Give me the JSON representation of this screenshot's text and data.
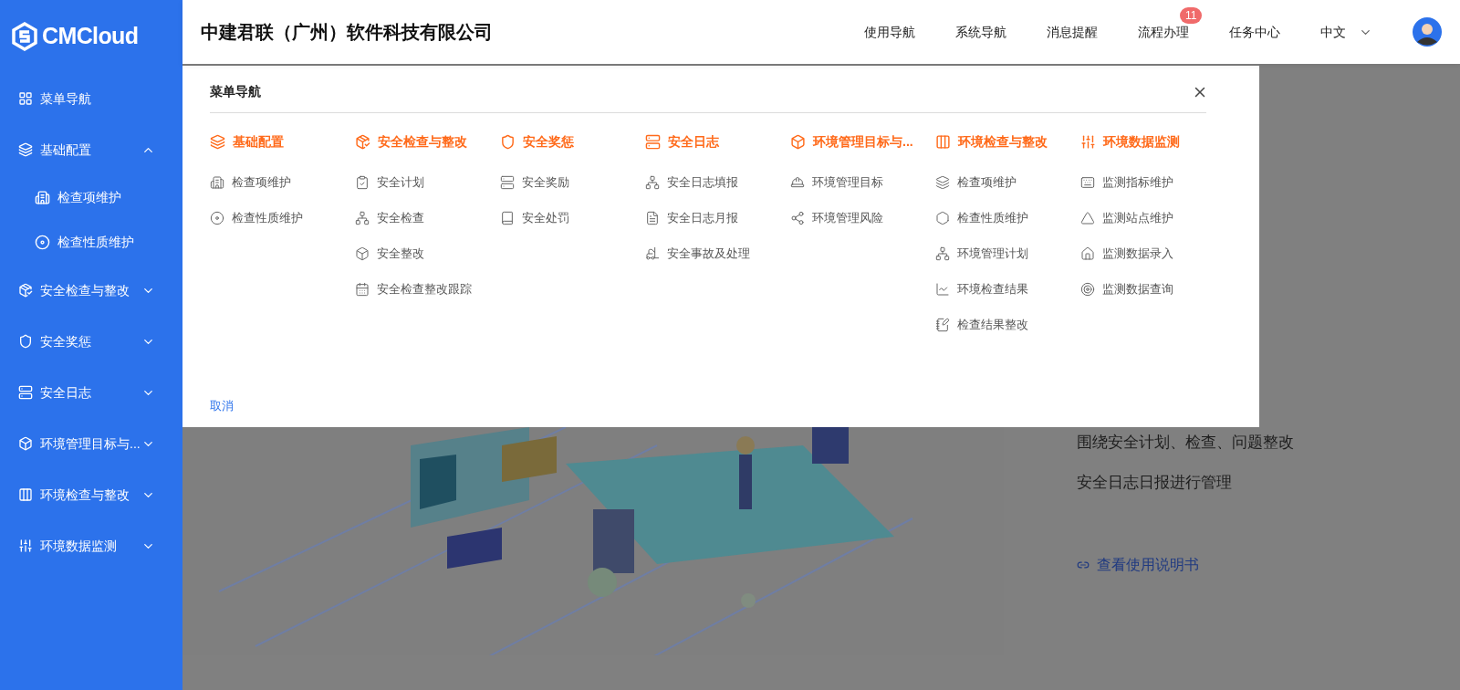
{
  "logo": {
    "text": "CMCloud"
  },
  "sidebar": {
    "items": [
      {
        "label": "菜单导航",
        "kind": "link"
      },
      {
        "label": "基础配置",
        "kind": "group",
        "expanded": true,
        "children": [
          {
            "label": "检查项维护"
          },
          {
            "label": "检查性质维护"
          }
        ]
      },
      {
        "label": "安全检查与整改",
        "kind": "group",
        "expanded": false
      },
      {
        "label": "安全奖惩",
        "kind": "group",
        "expanded": false
      },
      {
        "label": "安全日志",
        "kind": "group",
        "expanded": false
      },
      {
        "label": "环境管理目标与...",
        "kind": "group",
        "expanded": false
      },
      {
        "label": "环境检查与整改",
        "kind": "group",
        "expanded": false
      },
      {
        "label": "环境数据监测",
        "kind": "group",
        "expanded": false
      }
    ]
  },
  "header": {
    "title": "中建君联（广州）软件科技有限公司",
    "nav": [
      {
        "label": "使用导航"
      },
      {
        "label": "系统导航"
      },
      {
        "label": "消息提醒"
      },
      {
        "label": "流程办理",
        "badge": "11"
      },
      {
        "label": "任务中心"
      }
    ],
    "language": "中文"
  },
  "menu_panel": {
    "title": "菜单导航",
    "cancel": "取消",
    "columns": [
      {
        "heading": "基础配置",
        "items": [
          "检查项维护",
          "检查性质维护"
        ]
      },
      {
        "heading": "安全检查与整改",
        "items": [
          "安全计划",
          "安全检查",
          "安全整改",
          "安全检查整改跟踪"
        ]
      },
      {
        "heading": "安全奖惩",
        "items": [
          "安全奖励",
          "安全处罚"
        ]
      },
      {
        "heading": "安全日志",
        "items": [
          "安全日志填报",
          "安全日志月报",
          "安全事故及处理"
        ]
      },
      {
        "heading": "环境管理目标与...",
        "items": [
          "环境管理目标",
          "环境管理风险"
        ]
      },
      {
        "heading": "环境检查与整改",
        "items": [
          "检查项维护",
          "检查性质维护",
          "环境管理计划",
          "环境检查结果",
          "检查结果整改"
        ]
      },
      {
        "heading": "环境数据监测",
        "items": [
          "监测指标维护",
          "监测站点维护",
          "监测数据录入",
          "监测数据查询"
        ]
      }
    ]
  },
  "intro": {
    "lines": [
      "围绕安全计划、检查、问题整改",
      "安全日志日报进行管理"
    ],
    "link": "查看使用说明书"
  }
}
